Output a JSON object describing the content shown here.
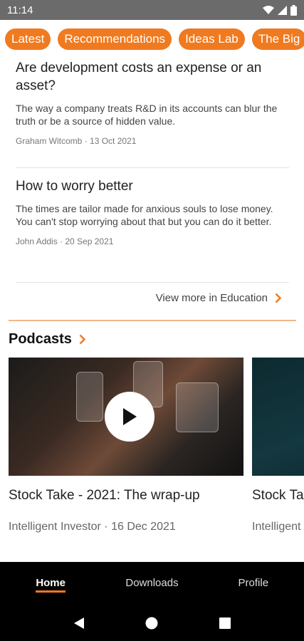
{
  "status_bar": {
    "time": "11:14"
  },
  "chips": [
    "Latest",
    "Recommendations",
    "Ideas Lab",
    "The Big"
  ],
  "articles": [
    {
      "title": "Are development costs an expense or an asset?",
      "summary": "The way a company treats R&D in its accounts can blur the truth or be a source of hidden value.",
      "meta": "Graham Witcomb · 13 Oct 2021"
    },
    {
      "title": "How to worry better",
      "summary": "The times are tailor made for anxious souls to lose money. You can't stop worrying about that but you can do it better.",
      "meta": "John Addis · 20 Sep 2021"
    }
  ],
  "view_more": "View more in Education",
  "podcasts": {
    "title": "Podcasts",
    "items": [
      {
        "title": "Stock Take - 2021: The wrap-up",
        "meta": "Intelligent Investor · 16 Dec 2021"
      },
      {
        "title": "Stock Ta",
        "meta": "Intelligent"
      }
    ]
  },
  "bottom_nav": {
    "items": [
      "Home",
      "Downloads",
      "Profile"
    ],
    "active": "Home"
  },
  "colors": {
    "accent": "#f07a20",
    "nav_bg": "#000000",
    "status_bg": "#6b6b6b"
  }
}
